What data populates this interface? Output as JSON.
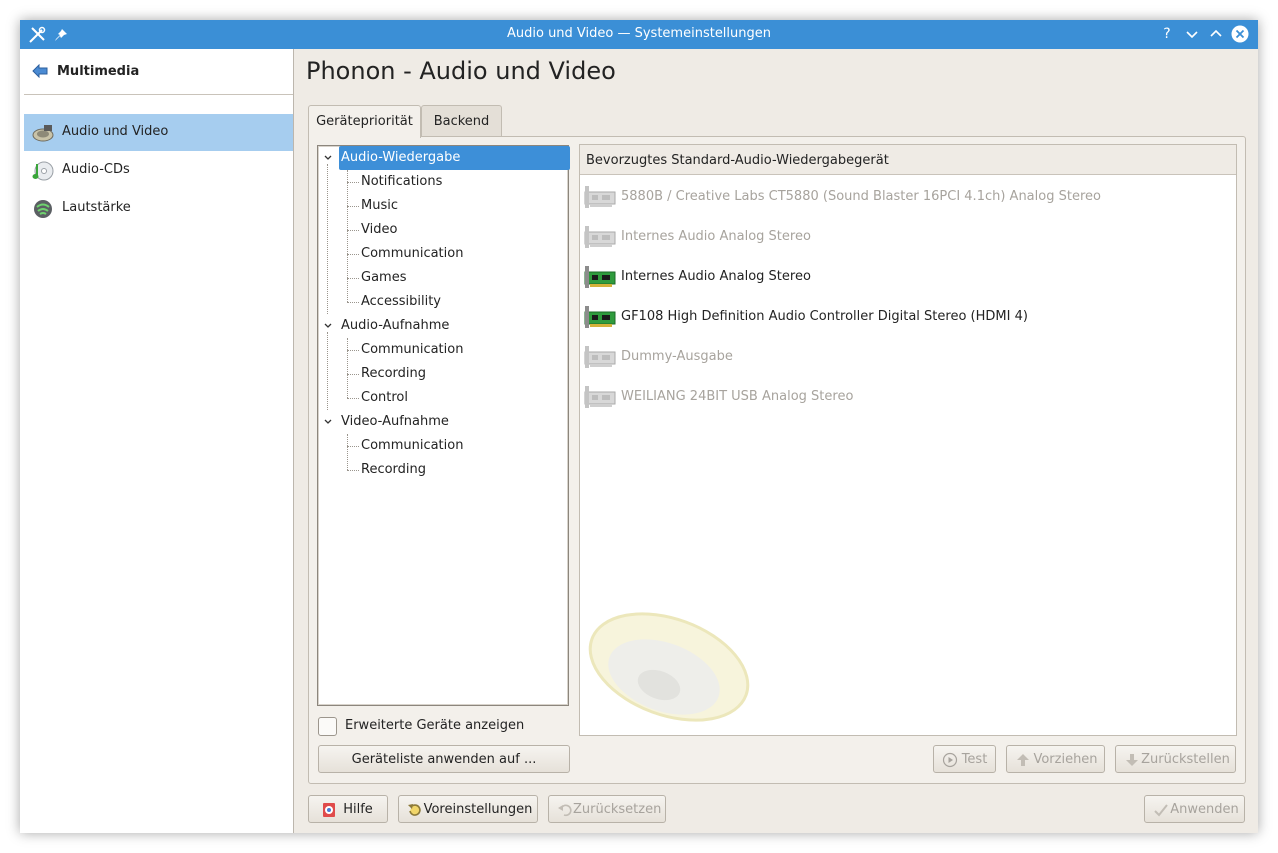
{
  "window": {
    "title": "Audio und Video — Systemeinstellungen",
    "accent": "#3b8fd6",
    "buttons": [
      "help",
      "minimize",
      "maximize",
      "close"
    ],
    "help_glyph": "?"
  },
  "sidebar": {
    "header": "Multimedia",
    "items": [
      {
        "label": "Audio und Video",
        "icon": "audio-video-icon",
        "selected": true
      },
      {
        "label": "Audio-CDs",
        "icon": "audio-cd-icon",
        "selected": false
      },
      {
        "label": "Lautstärke",
        "icon": "volume-icon",
        "selected": false
      }
    ]
  },
  "main": {
    "title": "Phonon - Audio und Video",
    "tabs": [
      {
        "label": "Gerätepriorität",
        "active": true
      },
      {
        "label": "Backend",
        "active": false
      }
    ],
    "tree": [
      {
        "label": "Audio-Wiedergabe",
        "level": 0,
        "expanded": true,
        "selected": true
      },
      {
        "label": "Notifications",
        "level": 1
      },
      {
        "label": "Music",
        "level": 1
      },
      {
        "label": "Video",
        "level": 1
      },
      {
        "label": "Communication",
        "level": 1
      },
      {
        "label": "Games",
        "level": 1
      },
      {
        "label": "Accessibility",
        "level": 1
      },
      {
        "label": "Audio-Aufnahme",
        "level": 0,
        "expanded": true
      },
      {
        "label": "Communication",
        "level": 1
      },
      {
        "label": "Recording",
        "level": 1
      },
      {
        "label": "Control",
        "level": 1
      },
      {
        "label": "Video-Aufnahme",
        "level": 0,
        "expanded": true
      },
      {
        "label": "Communication",
        "level": 1
      },
      {
        "label": "Recording",
        "level": 1
      }
    ],
    "device_list": {
      "header": "Bevorzugtes Standard-Audio-Wiedergabegerät",
      "devices": [
        {
          "label": "5880B / Creative Labs CT5880 (Sound Blaster 16PCI 4.1ch) Analog Stereo",
          "available": false
        },
        {
          "label": "Internes Audio Analog Stereo",
          "available": false
        },
        {
          "label": "Internes Audio Analog Stereo",
          "available": true
        },
        {
          "label": "GF108 High Definition Audio Controller Digital Stereo (HDMI 4)",
          "available": true
        },
        {
          "label": "Dummy-Ausgabe",
          "available": false
        },
        {
          "label": "WEILIANG 24BIT USB Analog Stereo",
          "available": false
        }
      ]
    },
    "show_advanced": {
      "label": "Erweiterte Geräte anzeigen",
      "checked": false
    },
    "apply_list_button": "Geräteliste anwenden auf ...",
    "test_button": "Test",
    "prefer_button": "Vorziehen",
    "defer_button": "Zurückstellen"
  },
  "footer": {
    "help": "Hilfe",
    "defaults": "Voreinstellungen",
    "reset": "Zurücksetzen",
    "apply": "Anwenden"
  }
}
